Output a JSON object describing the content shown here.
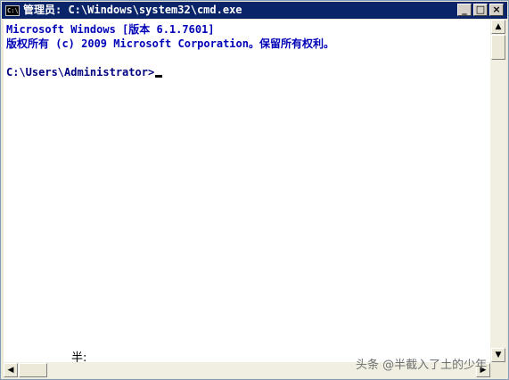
{
  "window": {
    "title": "管理员: C:\\Windows\\system32\\cmd.exe",
    "icon_text": "C:\\",
    "controls": {
      "minimize": "_",
      "maximize": "□",
      "close": "×"
    }
  },
  "console": {
    "lines": [
      "Microsoft Windows [版本 6.1.7601]",
      "版权所有 (c) 2009 Microsoft Corporation。保留所有权利。"
    ],
    "prompt": "C:\\Users\\Administrator>"
  },
  "ime": {
    "status": "半:"
  },
  "scrollbar": {
    "up": "▲",
    "down": "▼",
    "left": "◀",
    "right": "▶"
  },
  "watermark": "头条 @半截入了土的少年"
}
